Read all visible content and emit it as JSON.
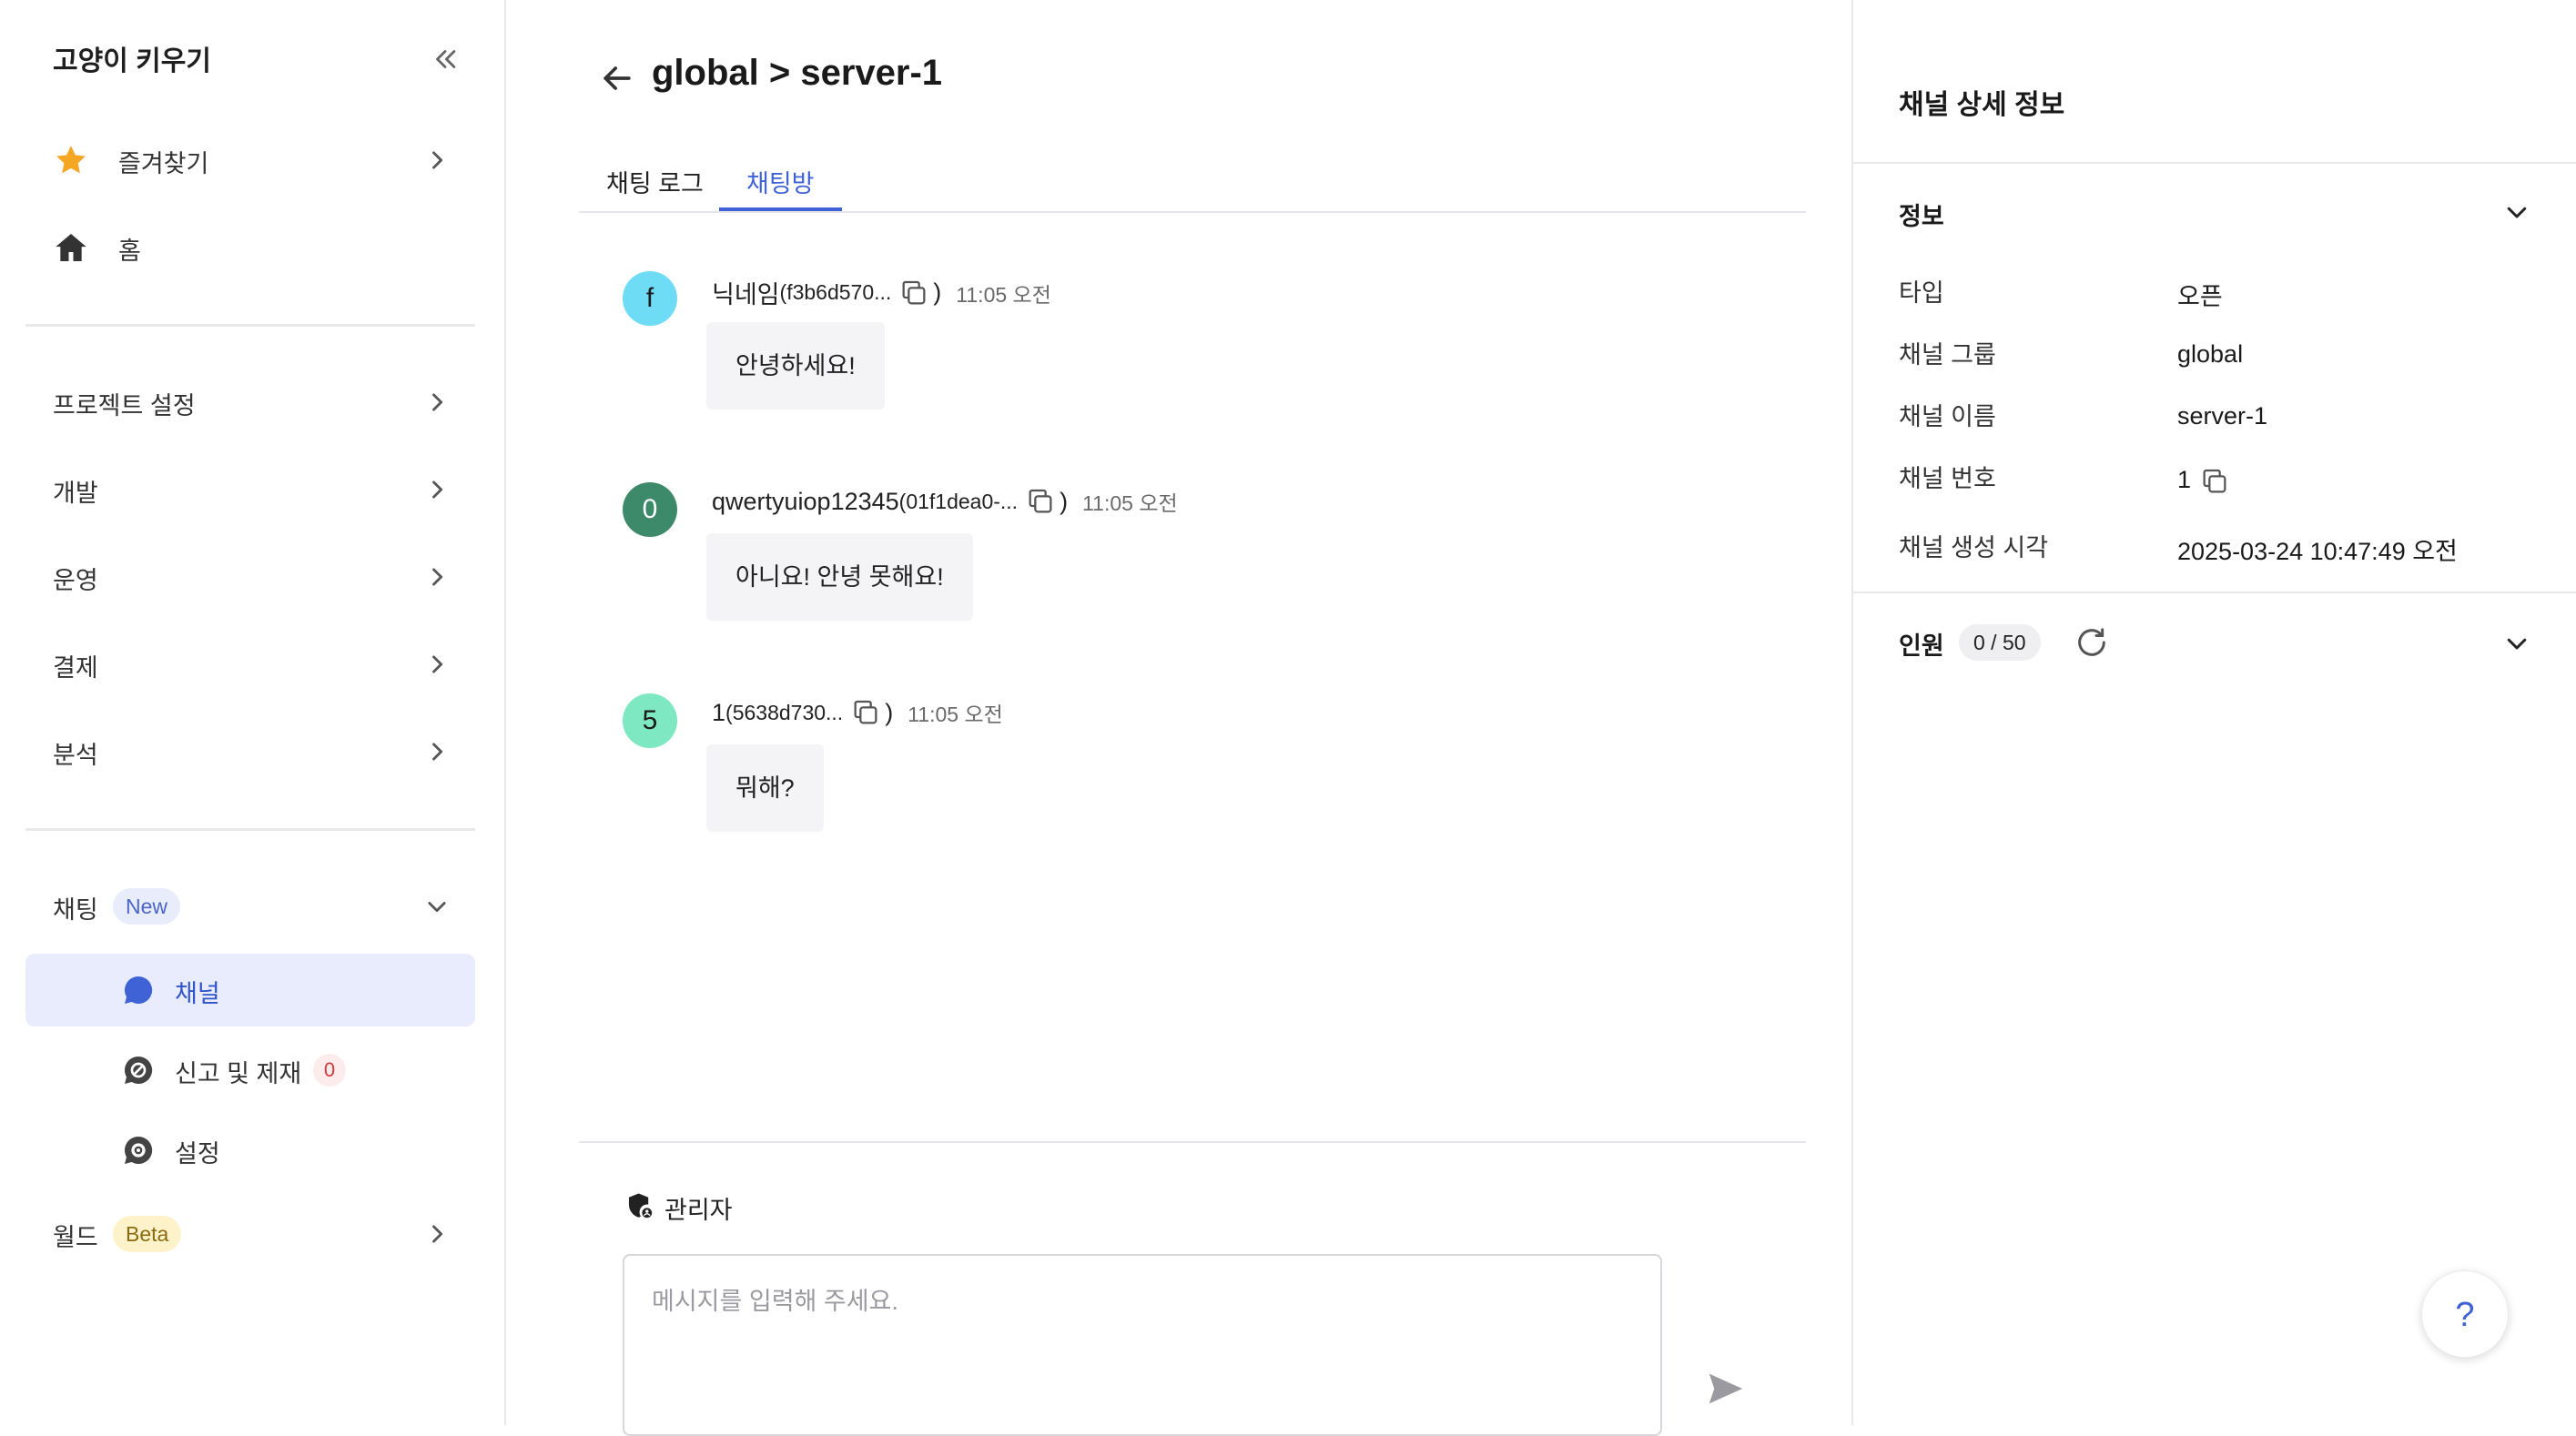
{
  "sidebar": {
    "title": "고양이 키우기",
    "favorites": "즐겨찾기",
    "home": "홈",
    "project_settings": "프로젝트 설정",
    "development": "개발",
    "operations": "운영",
    "payment": "결제",
    "analytics": "분석",
    "chat": "채팅",
    "chat_badge": "New",
    "channel": "채널",
    "report": "신고 및 제재",
    "report_count": "0",
    "settings": "설정",
    "world": "월드",
    "world_badge": "Beta"
  },
  "main": {
    "title": "global > server-1",
    "tabs": [
      {
        "label": "채팅 로그",
        "active": false
      },
      {
        "label": "채팅방",
        "active": true
      }
    ],
    "messages": [
      {
        "avatar": "f",
        "avatar_color": "#6fdcf5",
        "name": "닉네임",
        "id": "(f3b6d570...",
        "close": ")",
        "time": "11:05 오전",
        "text": "안녕하세요!"
      },
      {
        "avatar": "0",
        "avatar_color": "#3d8a6b",
        "name": "qwertyuiop12345",
        "id": "(01f1dea0-...",
        "close": ")",
        "time": "11:05 오전",
        "text": "아니요! 안녕 못해요!"
      },
      {
        "avatar": "5",
        "avatar_color": "#7ee8c2",
        "name": "1",
        "id": "(5638d730...",
        "close": ")",
        "time": "11:05 오전",
        "text": "뭐해?"
      }
    ],
    "sender_role": "관리자",
    "composer_placeholder": "메시지를 입력해 주세요."
  },
  "panel": {
    "title": "채널 상세 정보",
    "info_section": "정보",
    "fields": [
      {
        "key": "타입",
        "value": "오픈"
      },
      {
        "key": "채널 그룹",
        "value": "global"
      },
      {
        "key": "채널 이름",
        "value": "server-1"
      },
      {
        "key": "채널 번호",
        "value": "1"
      },
      {
        "key": "채널 생성 시각",
        "value": "2025-03-24 10:47:49 오전"
      }
    ],
    "members_section": "인원",
    "members_count": "0 / 50"
  },
  "help": "?",
  "colors": {
    "accent": "#3f63d6",
    "active_bg": "#e8ecfc",
    "star": "#f5a623"
  }
}
